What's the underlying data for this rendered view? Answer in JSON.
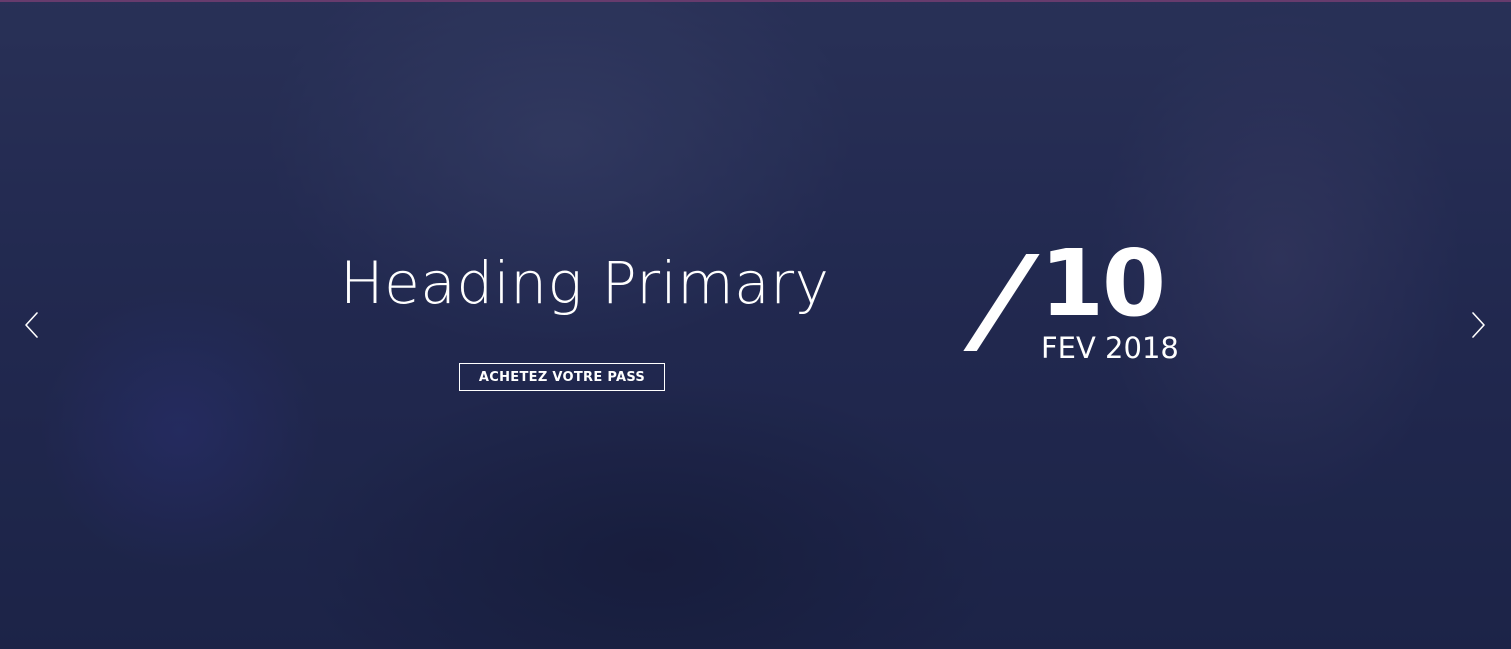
{
  "slide": {
    "heading": "Heading Primary",
    "cta_label": "ACHETEZ VOTRE PASS",
    "date": {
      "slash": "/",
      "day": "10",
      "month_year": "FEV 2018"
    }
  },
  "carousel": {
    "prev_icon": "chevron-left-icon",
    "next_icon": "chevron-right-icon"
  },
  "colors": {
    "overlay": "#1c2248",
    "accent_line": "#c35a9a",
    "text": "#ffffff"
  }
}
